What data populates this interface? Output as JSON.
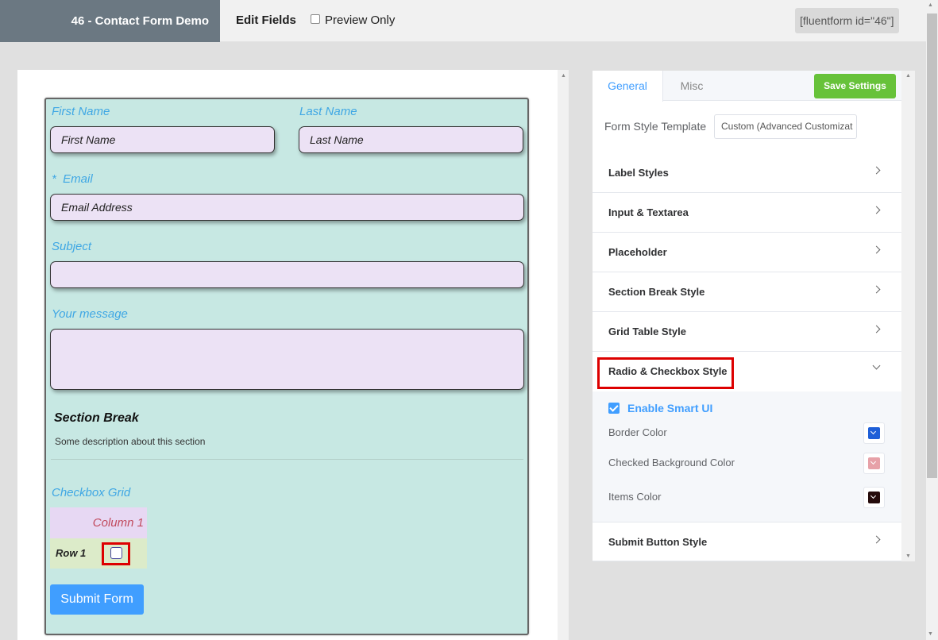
{
  "header": {
    "form_title": "46 - Contact Form Demo",
    "edit_fields": "Edit Fields",
    "preview_only": "Preview Only",
    "shortcode": "[fluentform id=\"46\"]"
  },
  "form": {
    "first_name_label": "First Name",
    "first_name_placeholder": "First Name",
    "last_name_label": "Last Name",
    "last_name_placeholder": "Last Name",
    "email_label": "*  Email",
    "email_placeholder": "Email Address",
    "subject_label": "Subject",
    "message_label": "Your message",
    "section_title": "Section Break",
    "section_desc": "Some description about this section",
    "grid_label": "Checkbox Grid",
    "grid_column": "Column 1",
    "grid_row": "Row 1",
    "submit": "Submit Form"
  },
  "settings": {
    "tabs": [
      "General",
      "Misc"
    ],
    "save_label": "Save Settings",
    "template_label": "Form Style Template",
    "template_value": "Custom (Advanced Customizat",
    "sections": [
      "Label Styles",
      "Input & Textarea",
      "Placeholder",
      "Section Break Style",
      "Grid Table Style",
      "Radio & Checkbox Style",
      "Submit Button Style"
    ],
    "radio_checkbox": {
      "smart_ui_label": "Enable Smart UI",
      "border_color_label": "Border Color",
      "checked_bg_label": "Checked Background Color",
      "items_color_label": "Items Color"
    }
  },
  "colors": {
    "border_color": "#1e5fd8",
    "checked_bg_color": "#e7a1a8",
    "items_color": "#250b0b"
  }
}
